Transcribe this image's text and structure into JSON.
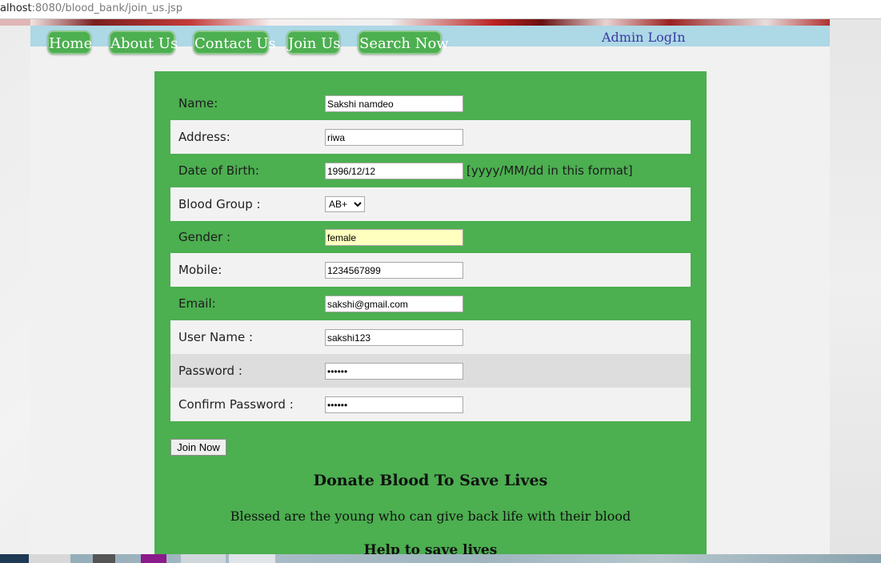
{
  "browser": {
    "url_host": "alhost",
    "url_path": ":8080/blood_bank/join_us.jsp"
  },
  "nav": {
    "items": [
      "Home",
      "About Us",
      "Contact Us",
      "Join Us",
      "Search Now"
    ],
    "admin": "Admin LogIn"
  },
  "form": {
    "name": {
      "label": "Name:",
      "value": "Sakshi namdeo"
    },
    "address": {
      "label": "Address:",
      "value": "riwa"
    },
    "dob": {
      "label": "Date of Birth:",
      "value": "1996/12/12",
      "hint": "[yyyy/MM/dd in this format]"
    },
    "blood_group": {
      "label": "Blood Group :",
      "value": "AB+"
    },
    "gender": {
      "label": "Gender :",
      "value": "female"
    },
    "mobile": {
      "label": "Mobile:",
      "value": "1234567899"
    },
    "email": {
      "label": "Email:",
      "value": "sakshi@gmail.com"
    },
    "username": {
      "label": "User Name :",
      "value": "sakshi123"
    },
    "password": {
      "label": "Password :",
      "value": "••••••"
    },
    "confirm_password": {
      "label": "Confirm Password :",
      "value": "••••••"
    },
    "submit": "Join Now"
  },
  "promo": {
    "heading": "Donate Blood To Save Lives",
    "text": "Blessed are the young who can give back life with their blood",
    "subheading": "Help to save lives"
  },
  "colors": {
    "panel": "#4caf50",
    "navbar": "#add8e6",
    "admin_link": "#3a3aa0"
  }
}
